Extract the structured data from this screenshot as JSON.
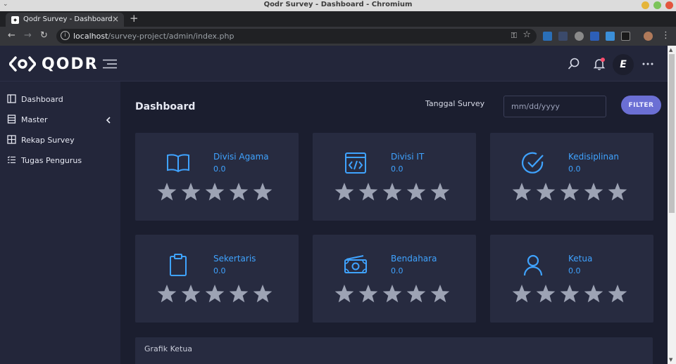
{
  "window": {
    "title": "Qodr Survey - Dashboard - Chromium"
  },
  "browser": {
    "tab_title": "Qodr Survey - Dashboard",
    "url_host": "localhost",
    "url_path": "/survey-project/admin/index.php"
  },
  "header": {
    "brand": "QODR",
    "avatar_letter": "E"
  },
  "sidebar": {
    "items": [
      {
        "label": "Dashboard",
        "icon": "columns-icon"
      },
      {
        "label": "Master",
        "icon": "list-box-icon",
        "has_chevron": true
      },
      {
        "label": "Rekap Survey",
        "icon": "grid-icon"
      },
      {
        "label": "Tugas Pengurus",
        "icon": "checklist-icon"
      }
    ]
  },
  "main": {
    "title": "Dashboard",
    "date_label": "Tanggal Survey",
    "date_placeholder": "mm/dd/yyyy",
    "filter_label": "FILTER",
    "cards": [
      {
        "name": "Divisi Agama",
        "score": "0.0",
        "icon": "book-icon",
        "stars": 5
      },
      {
        "name": "Divisi IT",
        "score": "0.0",
        "icon": "code-window-icon",
        "stars": 5
      },
      {
        "name": "Kedisiplinan",
        "score": "0.0",
        "icon": "check-circle-icon",
        "stars": 5
      },
      {
        "name": "Sekertaris",
        "score": "0.0",
        "icon": "clipboard-icon",
        "stars": 5
      },
      {
        "name": "Bendahara",
        "score": "0.0",
        "icon": "money-icon",
        "stars": 5
      },
      {
        "name": "Ketua",
        "score": "0.0",
        "icon": "user-icon",
        "stars": 5
      }
    ],
    "chart_section_label": "Grafik Ketua"
  },
  "colors": {
    "accent": "#3fa3ff",
    "button": "#6b6fd4",
    "star": "#9da3b4",
    "card_bg": "#272b40",
    "page_bg": "#1b1e2f"
  }
}
